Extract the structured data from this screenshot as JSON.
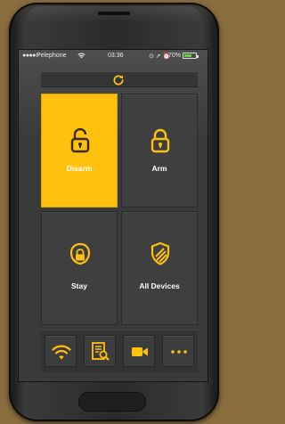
{
  "status_bar": {
    "signal": "●●●●○",
    "carrier": "Pelephone",
    "wifi_icon": "wifi-icon",
    "time": "03:36",
    "right_icons": "⊙ ➚ ⏰",
    "battery": "70%",
    "battery_level": 0.7,
    "battery_color": "#49d12e"
  },
  "refresh": {
    "icon": "refresh-icon"
  },
  "tiles": [
    {
      "label": "Disarm",
      "icon": "unlocked-padlock-icon",
      "active": true
    },
    {
      "label": "Arm",
      "icon": "locked-padlock-icon",
      "active": false
    },
    {
      "label": "Stay",
      "icon": "home-lock-icon",
      "active": false
    },
    {
      "label": "All Devices",
      "icon": "shield-icon",
      "active": false
    }
  ],
  "bottom_bar": [
    {
      "icon": "wifi-icon"
    },
    {
      "icon": "search-list-icon"
    },
    {
      "icon": "video-camera-icon"
    },
    {
      "icon": "more-icon"
    }
  ],
  "colors": {
    "accent": "#ffc10e",
    "tile": "#3f3f3f",
    "background": "#8a6d3f"
  }
}
